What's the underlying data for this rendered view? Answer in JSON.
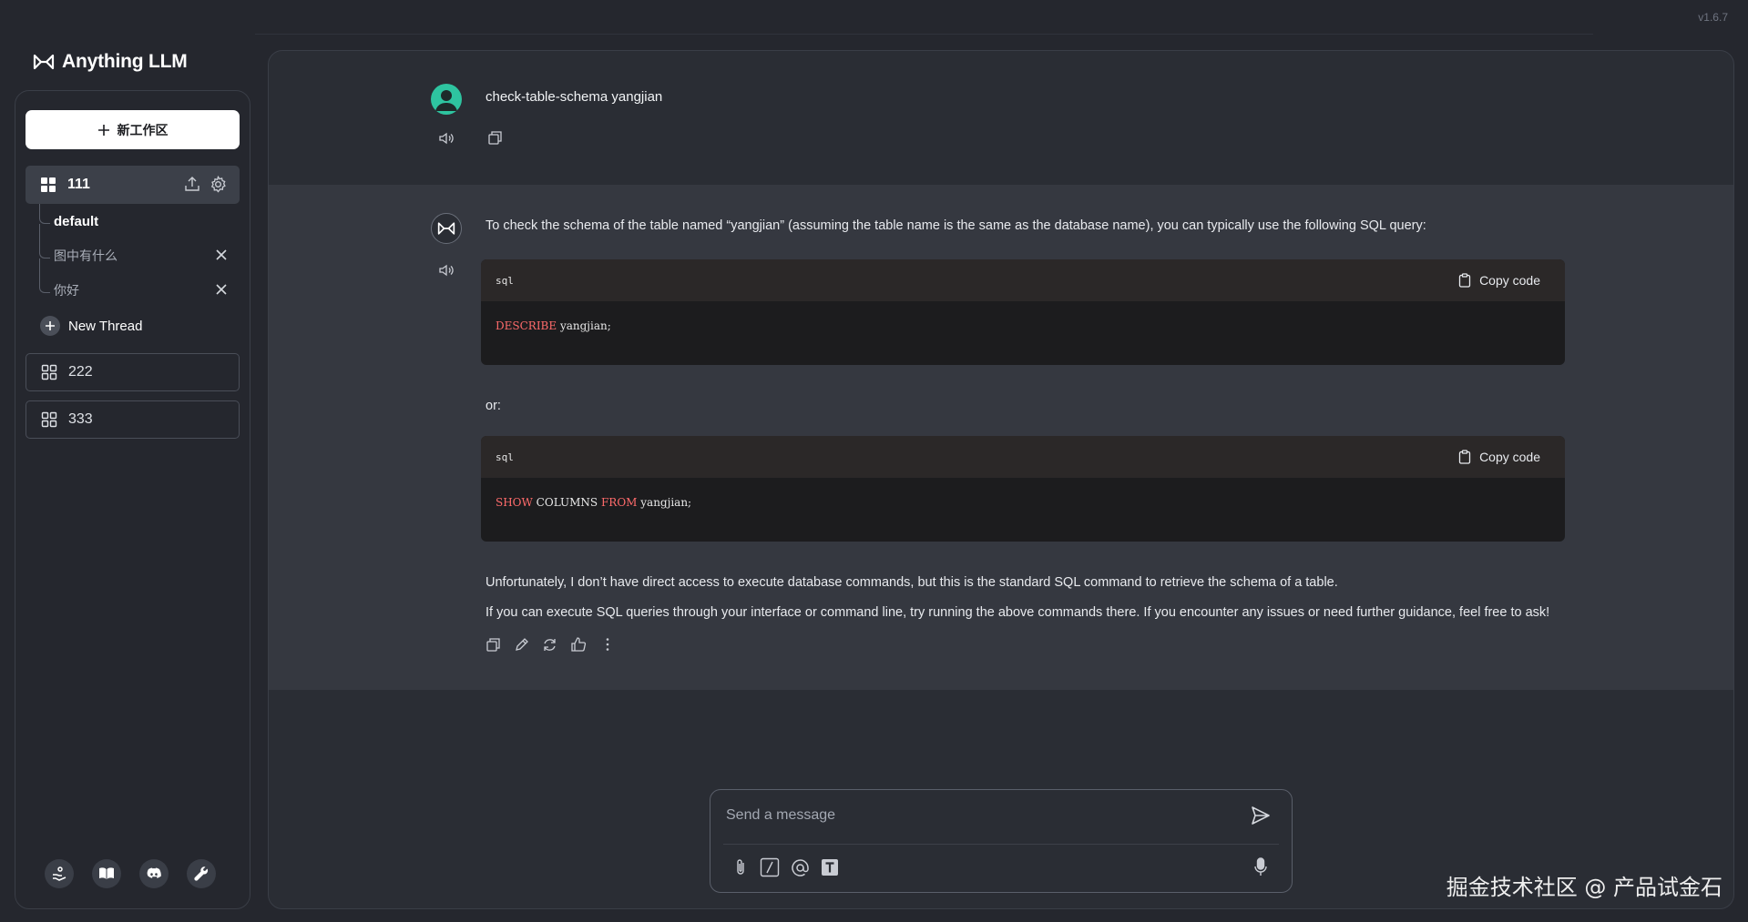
{
  "version": "v1.6.7",
  "app": {
    "name": "Anything LLM"
  },
  "sidebar": {
    "new_workspace_label": "新工作区",
    "active_workspace": {
      "name": "111"
    },
    "threads": [
      {
        "label": "default",
        "current": true
      },
      {
        "label": "图中有什么",
        "current": false
      },
      {
        "label": "你好",
        "current": false
      }
    ],
    "new_thread_label": "New Thread",
    "workspaces": [
      {
        "name": "222"
      },
      {
        "name": "333"
      }
    ],
    "footer_icons": [
      "support-icon",
      "docs-icon",
      "discord-icon",
      "settings-wrench-icon"
    ]
  },
  "chat": {
    "user_message": "check-table-schema yangjian",
    "assistant": {
      "intro": "To check the schema of the table named “yangjian” (assuming the table name is the same as the database name), you can typically use the following SQL query:",
      "code1": {
        "lang": "sql",
        "copy_label": "Copy code",
        "keyword": "DESCRIBE",
        "rest": " yangjian;"
      },
      "or_text": "or:",
      "code2": {
        "lang": "sql",
        "copy_label": "Copy code",
        "kw1": "SHOW",
        "mid": " COLUMNS ",
        "kw2": "FROM",
        "rest": " yangjian;"
      },
      "para1": "Unfortunately, I don’t have direct access to execute database commands, but this is the standard SQL command to retrieve the schema of a table.",
      "para2": "If you can execute SQL queries through your interface or command line, try running the above commands there. If you encounter any issues or need further guidance, feel free to ask!"
    }
  },
  "composer": {
    "placeholder": "Send a message"
  },
  "watermark": "掘金技术社区 @ 产品试金石",
  "colors": {
    "accent_user_avatar": "#2ec4a0",
    "code_keyword": "#ff6b6b",
    "panel": "#2a2d34"
  }
}
